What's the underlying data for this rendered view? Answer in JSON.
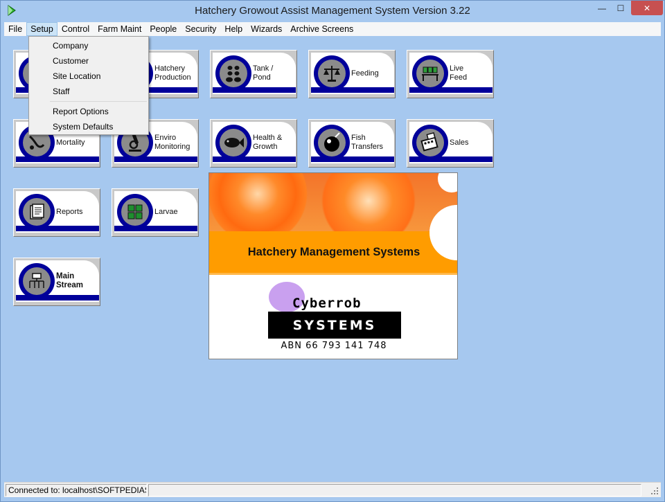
{
  "window": {
    "title": "Hatchery Growout Assist Management System Version 3.22",
    "controls": {
      "minimize": "—",
      "maximize": "☐",
      "close": "✕"
    }
  },
  "menubar": {
    "items": [
      {
        "label": "File"
      },
      {
        "label": "Setup"
      },
      {
        "label": "Control"
      },
      {
        "label": "Farm Maint"
      },
      {
        "label": "People"
      },
      {
        "label": "Security"
      },
      {
        "label": "Help"
      },
      {
        "label": "Wizards"
      },
      {
        "label": "Archive Screens"
      }
    ]
  },
  "setup_menu": {
    "items": [
      {
        "label": "Company"
      },
      {
        "label": "Customer"
      },
      {
        "label": "Site Location"
      },
      {
        "label": "Staff"
      },
      {
        "label": "Report Options"
      },
      {
        "label": "System Defaults"
      }
    ]
  },
  "tiles": {
    "hatchery_production": {
      "line1": "Hatchery",
      "line2": "Production",
      "icon": "hatchery-icon"
    },
    "tank_pond": {
      "line1": "Tank   /",
      "line2": "Pond",
      "icon": "tank-pond-icon"
    },
    "feeding": {
      "line1": "Feeding",
      "line2": "",
      "icon": "scales-icon"
    },
    "live_feed": {
      "line1": "Live",
      "line2": "Feed",
      "icon": "live-feed-icon"
    },
    "mortality": {
      "line1": "Mortality",
      "line2": "",
      "icon": "mortality-icon"
    },
    "enviro_monitoring": {
      "line1": "Enviro",
      "line2": "Monitoring",
      "icon": "microscope-icon"
    },
    "health_growth": {
      "line1": "Health &",
      "line2": "Growth",
      "icon": "fish-icon"
    },
    "fish_transfers": {
      "line1": "Fish",
      "line2": "Transfers",
      "icon": "fish-transfer-icon"
    },
    "sales": {
      "line1": "Sales",
      "line2": "",
      "icon": "register-icon"
    },
    "reports": {
      "line1": "Reports",
      "line2": "",
      "icon": "report-icon"
    },
    "larvae": {
      "line1": "Larvae",
      "line2": "",
      "icon": "larvae-icon"
    },
    "main_stream": {
      "line1": "Main",
      "line2": "Stream",
      "icon": "flowchart-icon"
    }
  },
  "banner": {
    "heading": "Hatchery Management Systems",
    "logo_word": "Cyberrob",
    "logo_box": "SYSTEMS",
    "abn": "ABN 66 793 141 748"
  },
  "statusbar": {
    "connection": "Connected to: localhost\\SOFTPEDIAS"
  },
  "colors": {
    "background": "#a6c8ef",
    "tile_band": "#00009a",
    "banner_orange": "#ff9c00",
    "close_button": "#c75050"
  }
}
